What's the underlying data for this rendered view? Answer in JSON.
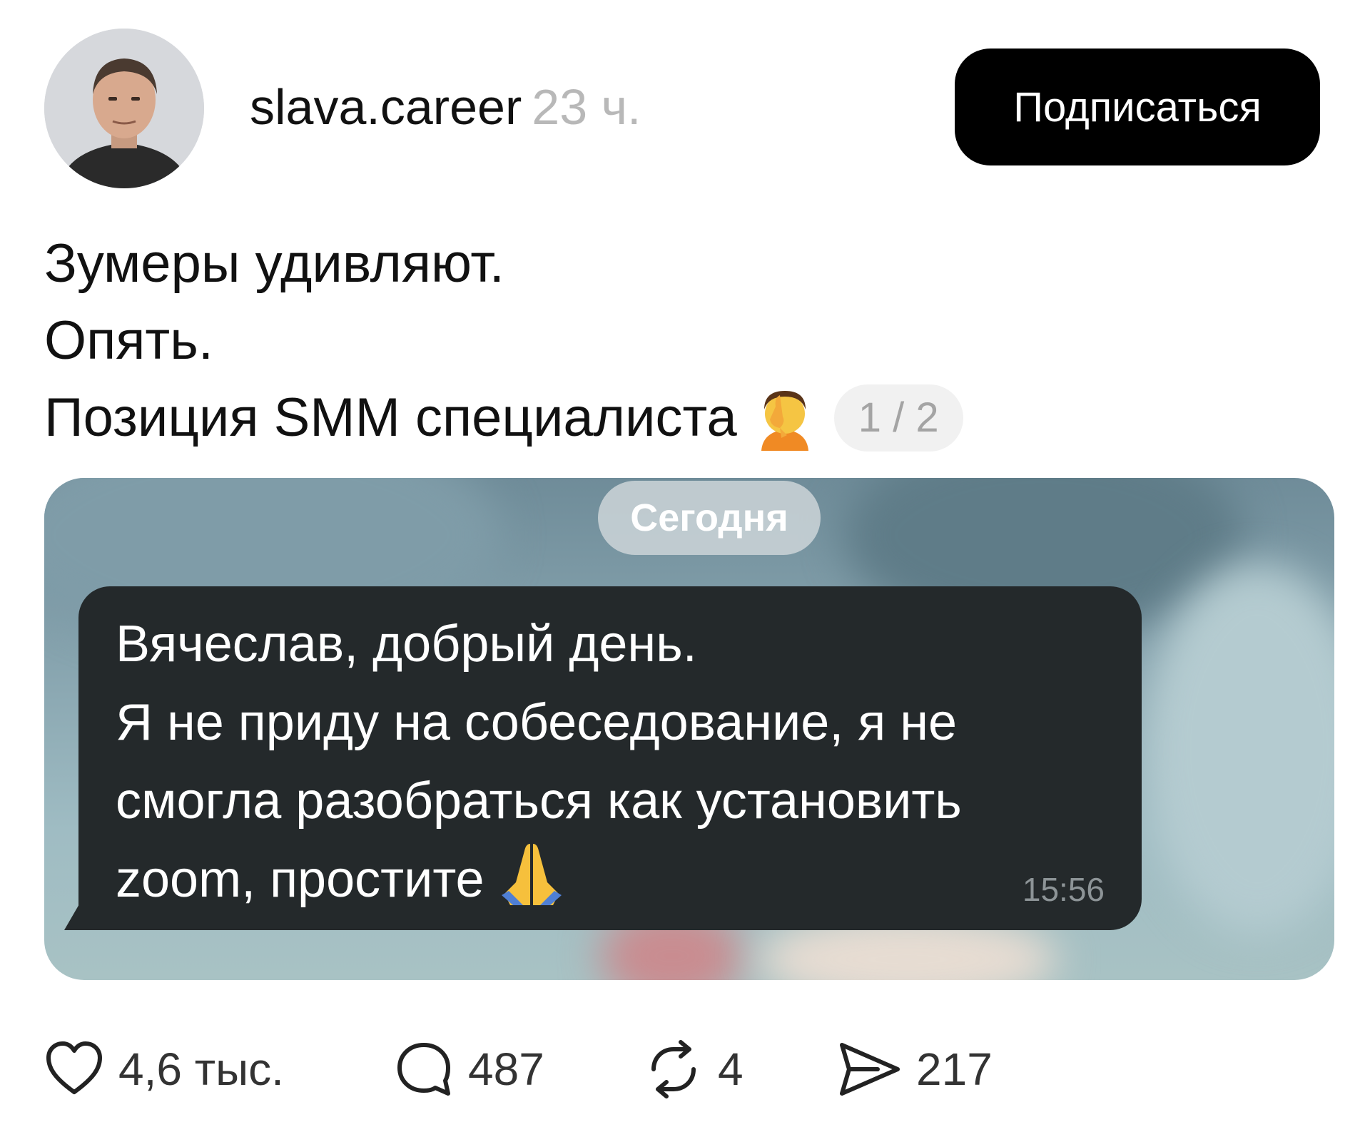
{
  "header": {
    "author_name": "slava.career",
    "post_time": "23 ч.",
    "subscribe_label": "Подписаться"
  },
  "post": {
    "lines": [
      "Зумеры удивляют.",
      "Опять.",
      "Позиция SMM специалиста"
    ],
    "facepalm_emoji": "facepalm-icon",
    "page_indicator": "1 / 2"
  },
  "image": {
    "date_label": "Сегодня",
    "message_lines": [
      "Вячеслав, добрый день.",
      "Я не приду на собеседование, я не",
      "смогла разобраться как установить",
      "zoom, простите"
    ],
    "message_emoji": "pray-icon",
    "message_time": "15:56"
  },
  "actions": {
    "likes": "4,6 тыс.",
    "comments": "487",
    "reposts": "4",
    "shares": "217"
  },
  "colors": {
    "subscribe_bg": "#000000",
    "bubble_bg": "#24292b",
    "muted_text": "#b8b8b8"
  }
}
